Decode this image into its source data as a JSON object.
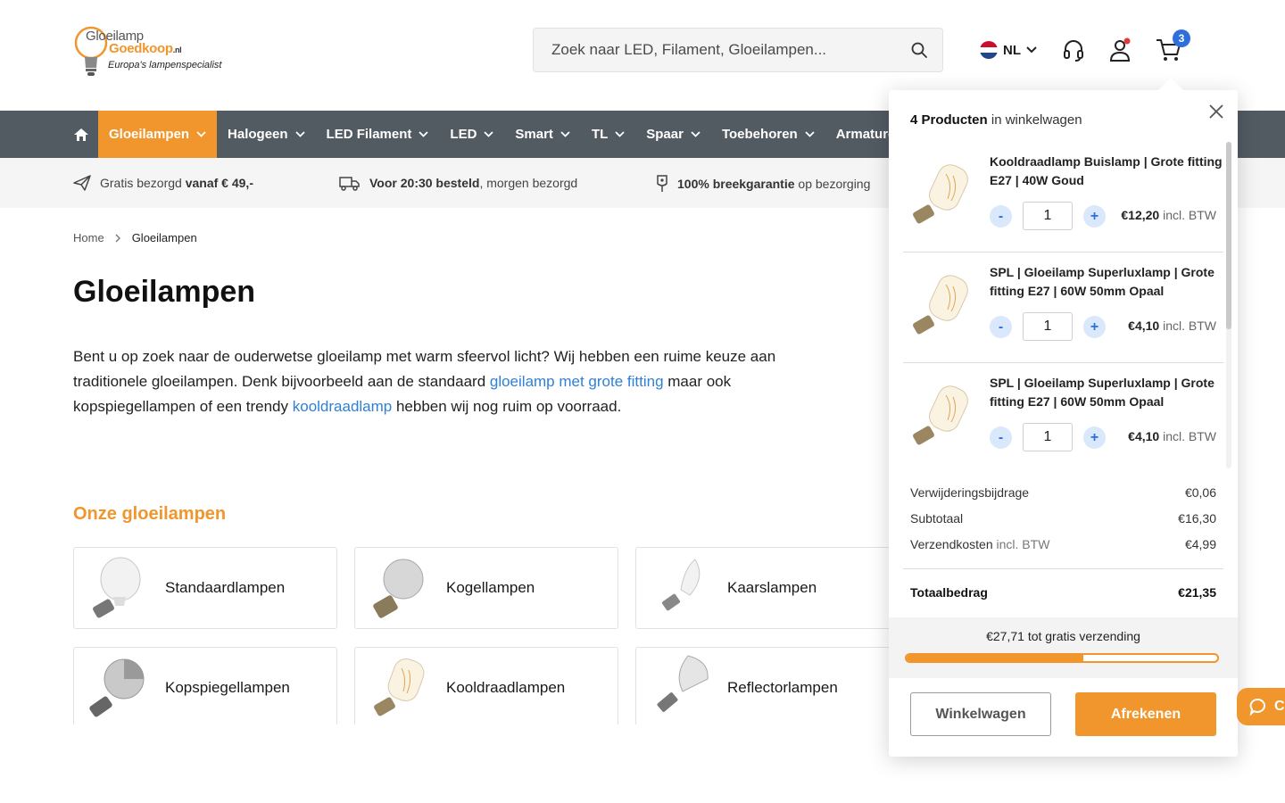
{
  "header": {
    "logo_line1": "Gloeilamp",
    "logo_line2": "Goedkoop",
    "logo_suffix": ".nl",
    "logo_tagline": "Europa's lampenspecialist",
    "search_placeholder": "Zoek naar LED, Filament, Gloeilampen...",
    "language": "NL",
    "cart_count": "3"
  },
  "nav": {
    "items": [
      {
        "label": "Gloeilampen",
        "active": true
      },
      {
        "label": "Halogeen"
      },
      {
        "label": "LED Filament"
      },
      {
        "label": "LED"
      },
      {
        "label": "Smart"
      },
      {
        "label": "TL"
      },
      {
        "label": "Spaar"
      },
      {
        "label": "Toebehoren"
      },
      {
        "label": "Armaturen"
      }
    ]
  },
  "usp": {
    "u1_pre": "Gratis bezorgd ",
    "u1_bold": "vanaf € 49,-",
    "u2_bold": "Voor 20:30 besteld",
    "u2_post": ", morgen bezorgd",
    "u3_bold": "100% breekgarantie",
    "u3_post": " op bezorging"
  },
  "breadcrumb": {
    "home": "Home",
    "current": "Gloeilampen"
  },
  "page": {
    "title": "Gloeilampen",
    "intro_1": "Bent u op zoek naar de ouderwetse gloeilamp met warm sfeervol licht? Wij hebben een ruime keuze aan traditionele gloeilampen. Denk bijvoorbeeld aan de standaard ",
    "intro_link1": "gloeilamp met grote fitting",
    "intro_2": " maar ook kopspiegellampen of een trendy ",
    "intro_link2": "kooldraadlamp",
    "intro_3": " hebben wij nog ruim op voorraad.",
    "section_title": "Onze gloeilampen",
    "categories": [
      "Standaardlampen",
      "Kogellampen",
      "Kaarslampen",
      "Kopspiegellampen",
      "Kooldraadlampen",
      "Reflectorlampen"
    ]
  },
  "cart": {
    "count_bold": "4 Producten",
    "count_rest": " in winkelwagen",
    "items": [
      {
        "name": "Kooldraadlamp Buislamp | Grote fitting E27 | 40W Goud",
        "qty": "1",
        "price": "€12,20",
        "price_note": " incl. BTW"
      },
      {
        "name": "SPL | Gloeilamp Superluxlamp | Grote fitting E27 | 60W 50mm Opaal",
        "qty": "1",
        "price": "€4,10",
        "price_note": " incl. BTW"
      },
      {
        "name": "SPL | Gloeilamp Superluxlamp | Grote fitting E27 | 60W 50mm Opaal",
        "qty": "1",
        "price": "€4,10",
        "price_note": " incl. BTW"
      }
    ],
    "qty_minus": "-",
    "qty_plus": "+",
    "fee_label": "Verwijderingsbijdrage",
    "fee_value": "€0,06",
    "subtotal_label": "Subtotaal",
    "subtotal_value": "€16,30",
    "shipping_label": "Verzendkosten",
    "shipping_note": " incl. BTW",
    "shipping_value": "€4,99",
    "total_label": "Totaalbedrag",
    "total_value": "€21,35",
    "free_shipping_text": "€27,71 tot gratis verzending",
    "free_shipping_progress": 0.57,
    "cart_button": "Winkelwagen",
    "checkout_button": "Afrekenen"
  },
  "chat": {
    "label": "C"
  },
  "colors": {
    "accent": "#f0962d",
    "nav_bg": "#525a62",
    "link": "#2f80d6",
    "badge": "#2f6fdb"
  }
}
